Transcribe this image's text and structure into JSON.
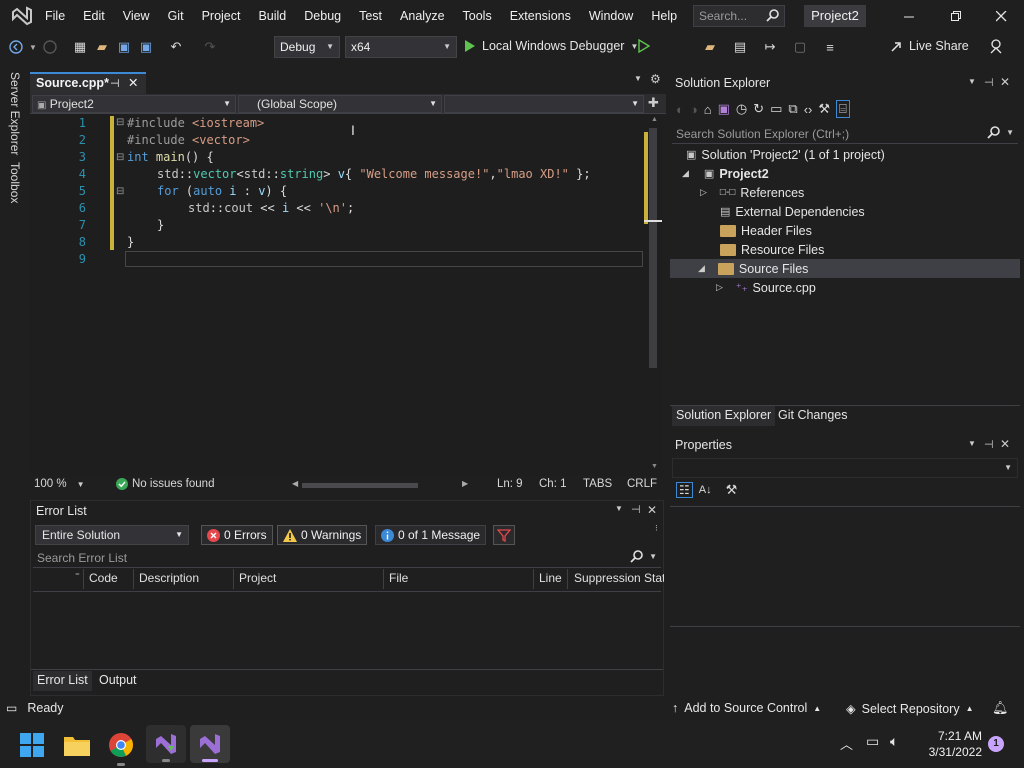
{
  "window": {
    "menu": [
      "File",
      "Edit",
      "View",
      "Git",
      "Project",
      "Build",
      "Debug",
      "Test",
      "Analyze",
      "Tools",
      "Extensions",
      "Window",
      "Help"
    ],
    "search_placeholder": "Search...",
    "project_name": "Project2"
  },
  "toolbar": {
    "config": "Debug",
    "platform": "x64",
    "run_label": "Local Windows Debugger",
    "live_share": "Live Share"
  },
  "side_tabs": {
    "server_explorer": "Server Explorer",
    "toolbox": "Toolbox"
  },
  "editor": {
    "tab_title": "Source.cpp*",
    "nav_project": "Project2",
    "nav_scope": "(Global Scope)",
    "line_numbers": [
      "1",
      "2",
      "3",
      "4",
      "5",
      "6",
      "7",
      "8",
      "9"
    ],
    "code": {
      "l1_a": "#include ",
      "l1_b": "<iostream>",
      "l2_a": "#include ",
      "l2_b": "<vector>",
      "l3_a": "int",
      "l3_b": " main",
      "l3_c": "() {",
      "l4_a": "std",
      "l4_b": "::",
      "l4_c": "vector",
      "l4_d": "<",
      "l4_e": "std",
      "l4_f": "::",
      "l4_g": "string",
      "l4_h": "> ",
      "l4_i": "v",
      "l4_j": "{ ",
      "l4_k": "\"Welcome message!\"",
      "l4_l": ",",
      "l4_m": "\"lmao XD!\"",
      "l4_n": " };",
      "l5_a": "for",
      "l5_b": " (",
      "l5_c": "auto",
      "l5_d": " i",
      "l5_e": " : ",
      "l5_f": "v",
      "l5_g": ") {",
      "l6_a": "std",
      "l6_b": "::",
      "l6_c": "cout",
      "l6_d": " << ",
      "l6_e": "i",
      "l6_f": " << ",
      "l6_g": "'\\n'",
      "l6_h": ";",
      "l7": "}",
      "l8": "}"
    },
    "zoom": "100 %",
    "issues": "No issues found",
    "ln": "Ln: 9",
    "ch": "Ch: 1",
    "tabs": "TABS",
    "eol": "CRLF"
  },
  "error_list": {
    "title": "Error List",
    "scope": "Entire Solution",
    "errors": "0 Errors",
    "warnings": "0 Warnings",
    "messages": "0 of 1 Message",
    "search_placeholder": "Search Error List",
    "columns": [
      "Code",
      "Description",
      "Project",
      "File",
      "Line",
      "Suppression State"
    ],
    "bottom_tabs": [
      "Error List",
      "Output"
    ]
  },
  "solution_explorer": {
    "title": "Solution Explorer",
    "search_placeholder": "Search Solution Explorer (Ctrl+;)",
    "solution_label": "Solution 'Project2' (1 of 1 project)",
    "project": "Project2",
    "items": [
      "References",
      "External Dependencies",
      "Header Files",
      "Resource Files",
      "Source Files"
    ],
    "file": "Source.cpp",
    "bottom_tabs": [
      "Solution Explorer",
      "Git Changes"
    ]
  },
  "properties": {
    "title": "Properties"
  },
  "statusbar": {
    "ready": "Ready",
    "add_source_control": "Add to Source Control",
    "select_repo": "Select Repository"
  },
  "taskbar": {
    "time": "7:21 AM",
    "date": "3/31/2022",
    "notification_count": "1"
  }
}
